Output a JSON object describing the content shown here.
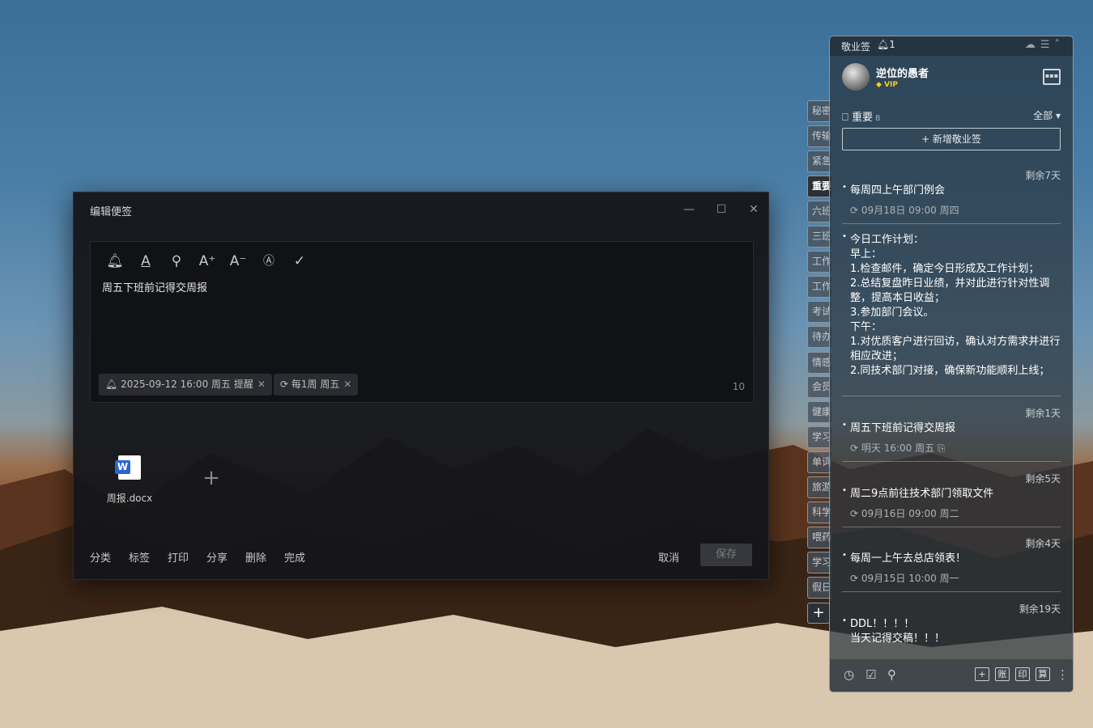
{
  "editor": {
    "title": "编辑便签",
    "minimize": "—",
    "maximize": "☐",
    "close": "✕",
    "text": "周五下班前记得交周报",
    "reminder": "2025-09-12 16:00 周五 提醒",
    "repeat": "每1周 周五",
    "char_count": "10",
    "attachment": {
      "icon": "W",
      "name": "周报.docx"
    },
    "add": "+",
    "actions": [
      "分类",
      "标签",
      "打印",
      "分享",
      "删除",
      "完成"
    ],
    "cancel": "取消",
    "save": "保存"
  },
  "tabs": [
    "秘密",
    "传输",
    "紧急",
    "重要",
    "六班",
    "三班",
    "工作",
    "工作",
    "考试",
    "待办",
    "情感",
    "会员",
    "健康",
    "学习",
    "单词",
    "旅游",
    "科学",
    "喂药",
    "学习",
    "假日"
  ],
  "tab_add": "+",
  "panel": {
    "title": "敬业签",
    "bell_count": "1",
    "user": "逆位的愚者",
    "vip": "VIP",
    "section": "重要",
    "section_count": "8",
    "filter": "全部 ▾",
    "add_note": "+ 新增敬业签",
    "notes": [
      {
        "remain": "剩余7天",
        "text": "每周四上午部门例会",
        "meta": "09月18日 09:00 周四"
      },
      {
        "remain": "",
        "text": "今日工作计划：\n早上：\n1.检查邮件，确定今日形成及工作计划；\n2.总结复盘昨日业绩，并对此进行针对性调整，提高本日收益；\n3.参加部门会议。\n下午：\n1.对优质客户进行回访，确认对方需求并进行相应改进；\n2.同技术部门对接，确保新功能顺利上线；",
        "meta": ""
      },
      {
        "remain": "剩余1天",
        "text": "周五下班前记得交周报",
        "meta": "明天 16:00 周五"
      },
      {
        "remain": "剩余5天",
        "text": "周二9点前往技术部门领取文件",
        "meta": "09月16日 09:00 周二"
      },
      {
        "remain": "剩余4天",
        "text": "每周一上午去总店领表！",
        "meta": "09月15日 10:00 周一"
      },
      {
        "remain": "剩余19天",
        "text": "DDL！！！！\n当天记得交稿！！！",
        "meta": ""
      }
    ],
    "bottom": {
      "b1": "账",
      "b2": "印",
      "b3": "算"
    }
  },
  "colors": {
    "accent": "#2b64d6",
    "vip": "#f5d020"
  }
}
